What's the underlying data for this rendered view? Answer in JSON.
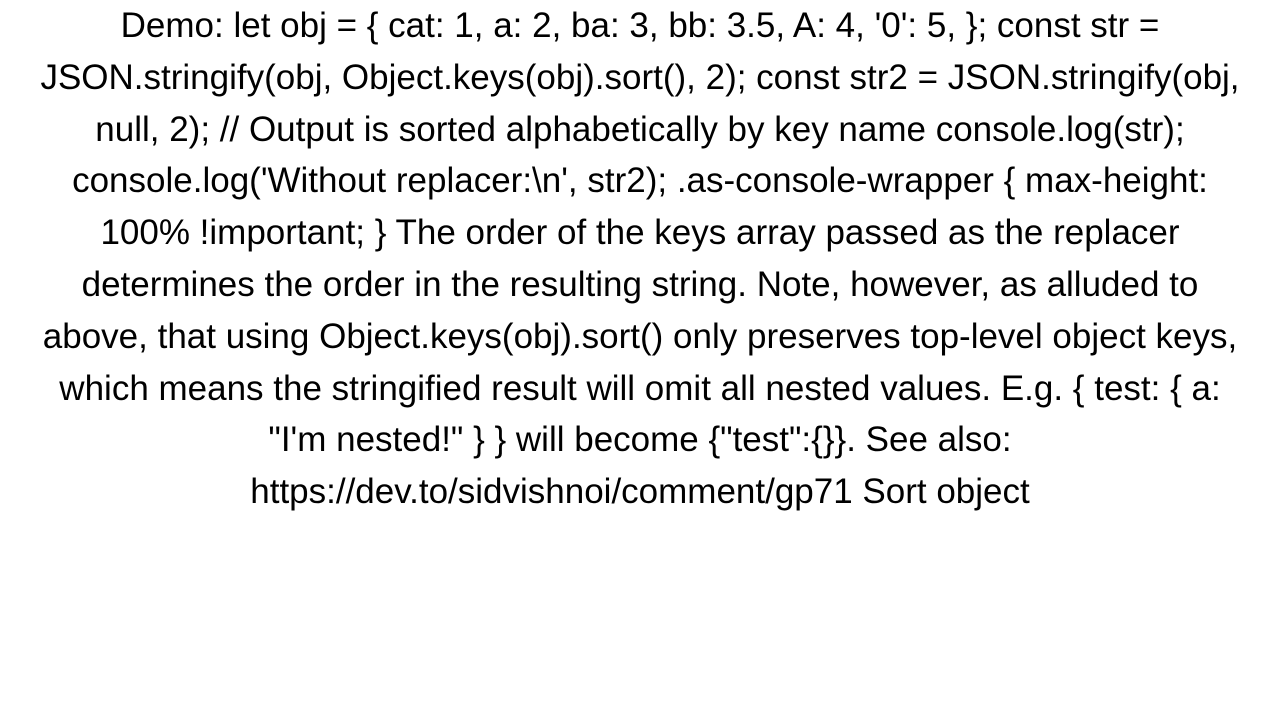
{
  "body_text": "Demo:   let obj = {   cat: 1,   a: 2,   ba: 3,   bb: 3.5,   A: 4,   '0': 5, };  const str = JSON.stringify(obj, Object.keys(obj).sort(), 2); const str2 = JSON.stringify(obj, null, 2);  // Output is sorted alphabetically by key name console.log(str); console.log('Without replacer:\\n', str2); .as-console-wrapper { max-height: 100% !important; }    The order of the keys array passed as the replacer determines the order in the resulting string. Note, however, as alluded to above, that using Object.keys(obj).sort() only preserves top-level object keys, which means the stringified result will omit all nested values. E.g. { test: { a: \"I'm nested!\" } } will become {\"test\":{}}. See also: https://dev.to/sidvishnoi/comment/gp71 Sort object"
}
